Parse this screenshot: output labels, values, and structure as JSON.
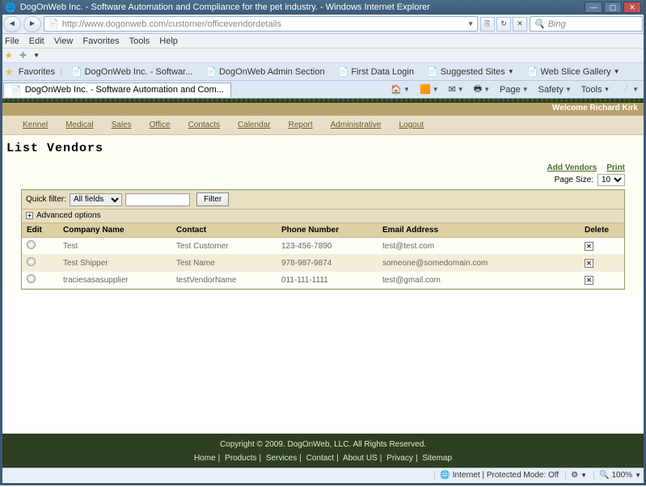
{
  "window": {
    "title": "DogOnWeb Inc. - Software Automation and Compliance for the pet industry. - Windows Internet Explorer",
    "url": "http://www.dogonweb.com/customer/officevendordetails",
    "search_placeholder": "Bing",
    "tab_title": "DogOnWeb Inc. - Software Automation and Com..."
  },
  "menubar": {
    "file": "File",
    "edit": "Edit",
    "view": "View",
    "favorites": "Favorites",
    "tools": "Tools",
    "help": "Help"
  },
  "favbar": {
    "label": "Favorites",
    "links": [
      "DogOnWeb Inc. - Softwar...",
      "DogOnWeb Admin Section",
      "First Data Login",
      "Suggested Sites",
      "Web Slice Gallery"
    ]
  },
  "ietools": {
    "page": "Page",
    "safety": "Safety",
    "tools": "Tools"
  },
  "welcome": "Welcome Richard Kirk",
  "nav": {
    "kennel": "Kennel",
    "medical": "Medical",
    "sales": "Sales",
    "office": "Office",
    "contacts": "Contacts",
    "calendar": "Calendar",
    "report": "Report",
    "admin": "Administrative",
    "logout": "Logout"
  },
  "page_title": "List Vendors",
  "actions": {
    "add": "Add Vendors",
    "print": "Print"
  },
  "pagesize": {
    "label": "Page Size:",
    "value": "10"
  },
  "filter": {
    "label": "Quick filter:",
    "field": "All fields",
    "value": "",
    "button": "Filter",
    "advanced_label": "Advanced options",
    "advanced_icon": "+"
  },
  "grid": {
    "headers": {
      "edit": "Edit",
      "company": "Company Name",
      "contact": "Contact",
      "phone": "Phone Number",
      "email": "Email Address",
      "del": "Delete"
    },
    "rows": [
      {
        "company": "Test",
        "contact": "Test Customer",
        "phone": "123-456-7890",
        "email": "test@test.com"
      },
      {
        "company": "Test Shipper",
        "contact": "Test Name",
        "phone": "978-987-9874",
        "email": "someone@somedomain.com"
      },
      {
        "company": "traciesasasupplier",
        "contact": "testVendorName",
        "phone": "011-111-1111",
        "email": "test@gmail.com"
      }
    ]
  },
  "footer": {
    "copyright": "Copyright © 2009.  DogOnWeb, LLC.  All Rights Reserved.",
    "links": [
      "Home",
      "Products",
      "Services",
      "Contact",
      "About US",
      "Privacy",
      "Sitemap"
    ]
  },
  "status": {
    "zone": "Internet | Protected Mode: Off",
    "zoom": "100%"
  }
}
